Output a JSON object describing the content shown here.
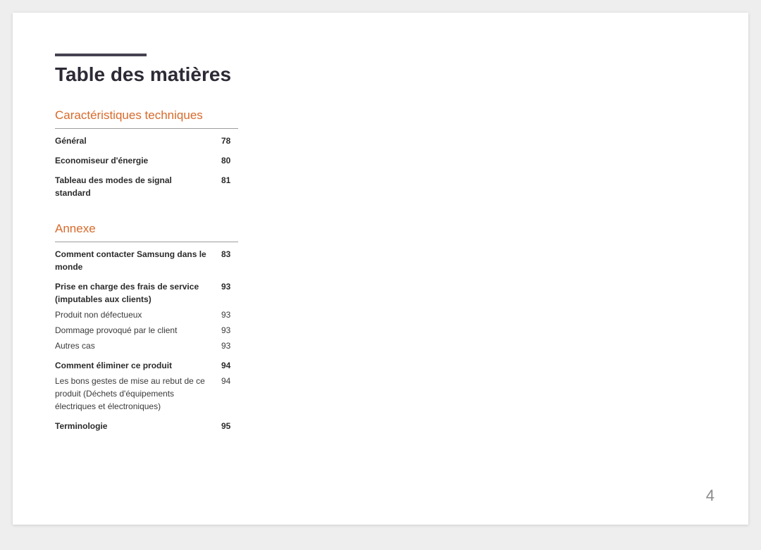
{
  "title": "Table des matières",
  "page_number": "4",
  "sections": [
    {
      "heading": "Caractéristiques techniques",
      "entries": [
        {
          "label": "Général",
          "page": "78",
          "bold": true,
          "gap": false
        },
        {
          "label": "Economiseur d'énergie",
          "page": "80",
          "bold": true,
          "gap": true
        },
        {
          "label": "Tableau des modes de signal standard",
          "page": "81",
          "bold": true,
          "gap": true
        }
      ]
    },
    {
      "heading": "Annexe",
      "entries": [
        {
          "label": "Comment contacter Samsung dans le monde",
          "page": "83",
          "bold": true,
          "gap": false
        },
        {
          "label": "Prise en charge des frais de service (imputables aux clients)",
          "page": "93",
          "bold": true,
          "gap": true
        },
        {
          "label": "Produit non défectueux",
          "page": "93",
          "bold": false,
          "gap": false
        },
        {
          "label": "Dommage provoqué par le client",
          "page": "93",
          "bold": false,
          "gap": false
        },
        {
          "label": "Autres cas",
          "page": "93",
          "bold": false,
          "gap": false
        },
        {
          "label": "Comment éliminer ce produit",
          "page": "94",
          "bold": true,
          "gap": true
        },
        {
          "label": "Les bons gestes de mise au rebut de ce produit (Déchets d'équipements électriques et électroniques)",
          "page": "94",
          "bold": false,
          "gap": false
        },
        {
          "label": "Terminologie",
          "page": "95",
          "bold": true,
          "gap": true
        }
      ]
    }
  ]
}
